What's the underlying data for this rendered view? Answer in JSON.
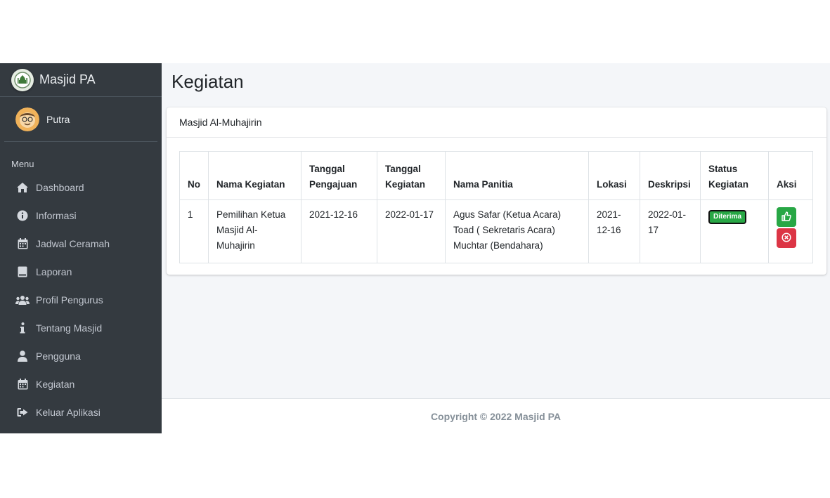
{
  "brand": {
    "name": "Masjid PA"
  },
  "user": {
    "name": "Putra"
  },
  "sidebar": {
    "header": "Menu",
    "items": [
      {
        "label": "Dashboard",
        "icon": "home-icon"
      },
      {
        "label": "Informasi",
        "icon": "info-circle-icon"
      },
      {
        "label": "Jadwal Ceramah",
        "icon": "calendar-icon"
      },
      {
        "label": "Laporan",
        "icon": "book-icon"
      },
      {
        "label": "Profil Pengurus",
        "icon": "users-icon"
      },
      {
        "label": "Tentang Masjid",
        "icon": "info-icon"
      },
      {
        "label": "Pengguna",
        "icon": "user-icon"
      },
      {
        "label": "Kegiatan",
        "icon": "calendar-icon"
      },
      {
        "label": "Keluar Aplikasi",
        "icon": "sign-out-icon"
      }
    ]
  },
  "page": {
    "title": "Kegiatan"
  },
  "card": {
    "title": "Masjid Al-Muhajirin"
  },
  "table": {
    "headers": {
      "no": "No",
      "nama": "Nama Kegiatan",
      "pengajuan": "Tanggal Pengajuan",
      "kegiatan": "Tanggal Kegiatan",
      "panitia": "Nama Panitia",
      "lokasi": "Lokasi",
      "deskripsi": "Deskripsi",
      "status": "Status Kegiatan",
      "aksi": "Aksi"
    },
    "rows": [
      {
        "no": "1",
        "nama": "Pemilihan Ketua Masjid Al-Muhajirin",
        "pengajuan": "2021-12-16",
        "kegiatan": "2022-01-17",
        "panitia": [
          "Agus Safar (Ketua Acara)",
          "Toad ( Sekretaris Acara)",
          "Muchtar (Bendahara)"
        ],
        "lokasi": "2021-12-16",
        "deskripsi": "2022-01-17",
        "status": "Diterima",
        "status_color": "#28a745"
      }
    ]
  },
  "footer": {
    "text": "Copyright © 2022 Masjid PA"
  },
  "colors": {
    "sidebar": "#343a40",
    "success": "#28a745",
    "danger": "#dc3545",
    "content_bg": "#f4f6f9"
  }
}
